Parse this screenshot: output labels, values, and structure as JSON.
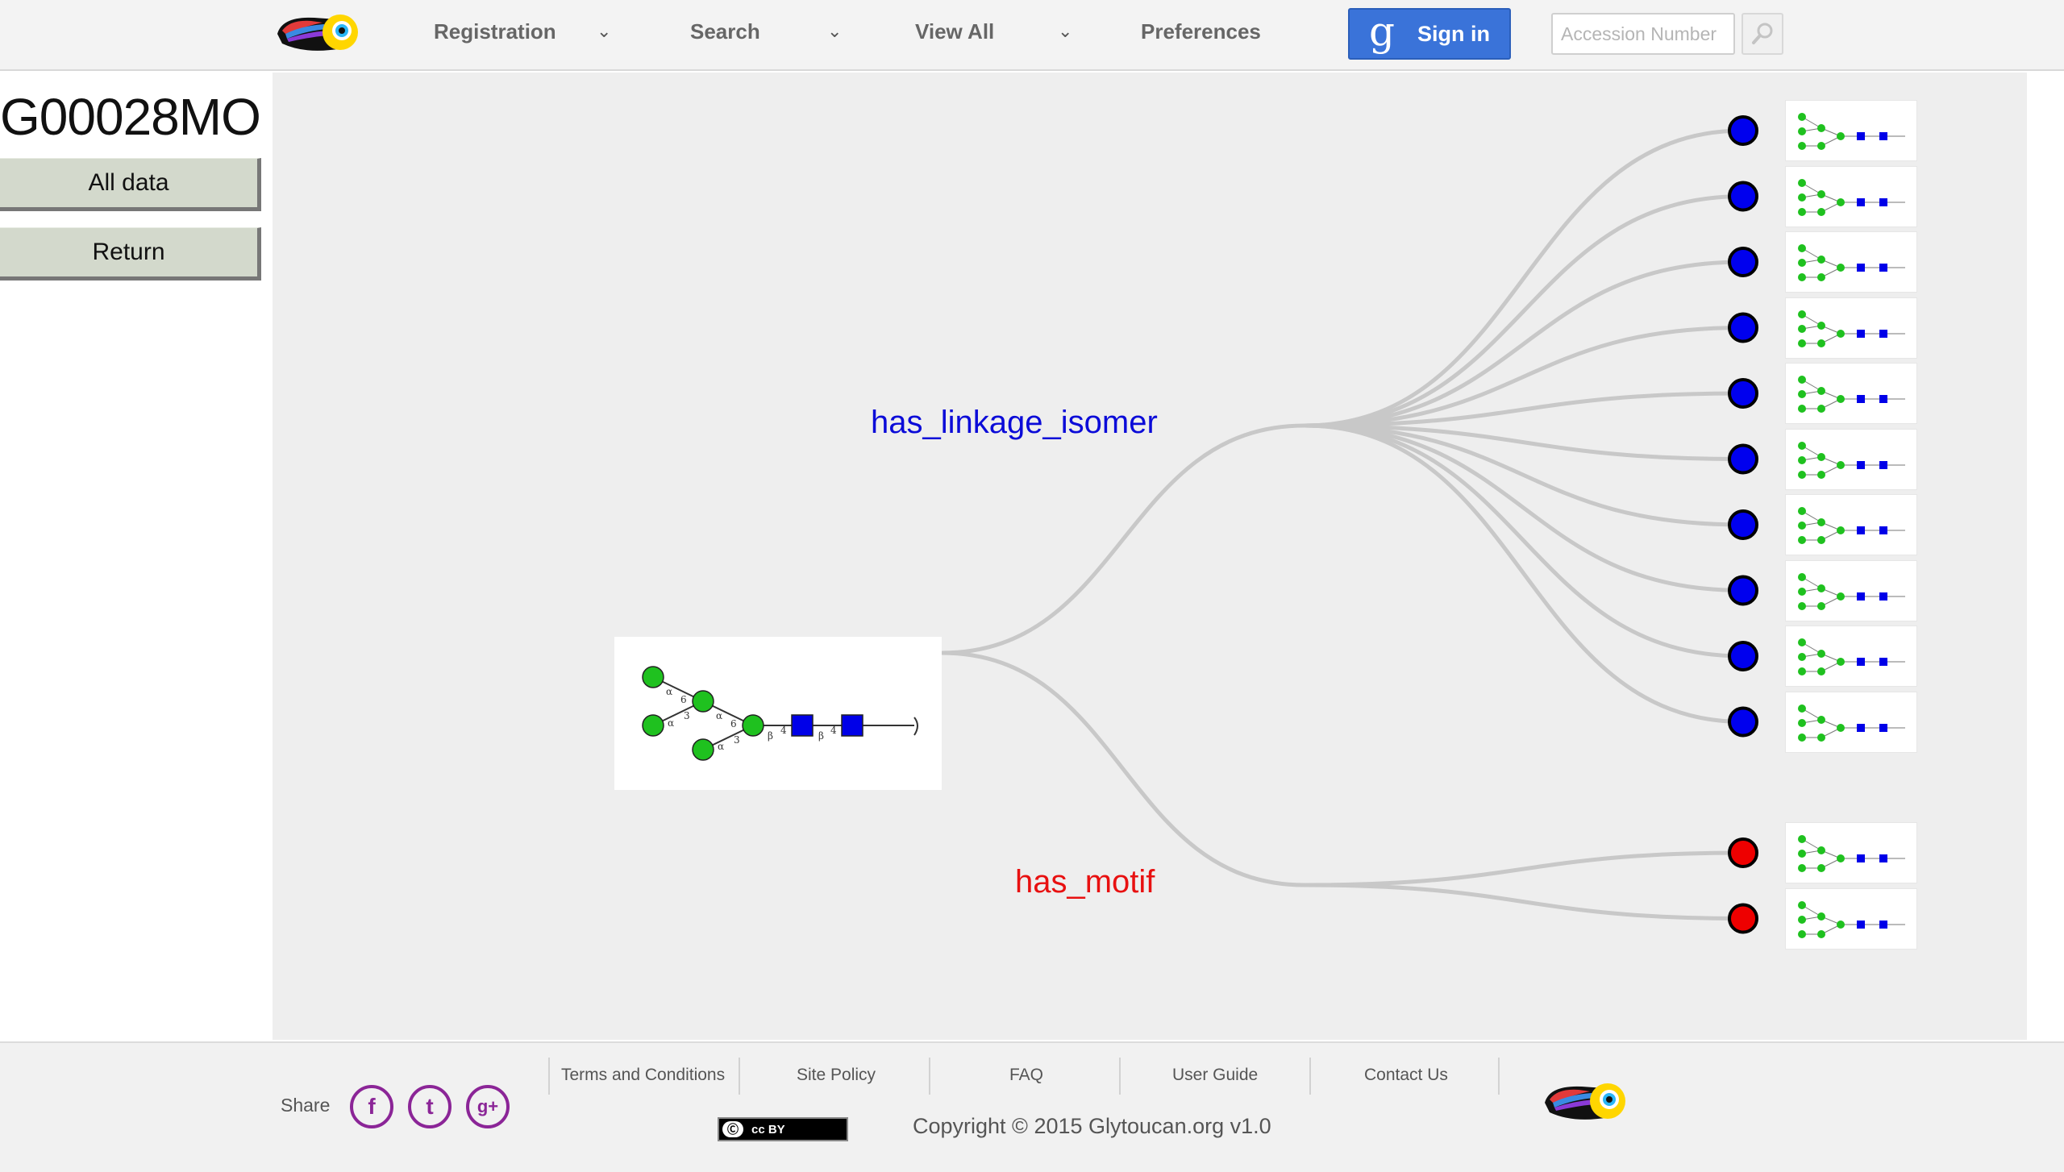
{
  "header": {
    "nav": [
      {
        "label": "Registration",
        "has_dropdown": true
      },
      {
        "label": "Search",
        "has_dropdown": true
      },
      {
        "label": "View All",
        "has_dropdown": true
      },
      {
        "label": "Preferences",
        "has_dropdown": false
      }
    ],
    "signin_label": "Sign in",
    "signin_icon": "g",
    "accession_placeholder": "Accession Number",
    "search_icon": "magnifier-icon"
  },
  "sidebar": {
    "title": "G00028MO",
    "buttons": [
      {
        "label": "All data"
      },
      {
        "label": "Return"
      }
    ]
  },
  "graph": {
    "relations": [
      {
        "label": "has_linkage_isomer",
        "color": "#0b0bd8",
        "node_color": "#0000ee",
        "count": 10
      },
      {
        "label": "has_motif",
        "color": "#e81010",
        "node_color": "#ee0000",
        "count": 2
      }
    ],
    "edge_color": "#c8c8c8",
    "glycan_colors": {
      "mannose": "#1fc11f",
      "glcnac": "#0000e8"
    },
    "linkage_text": [
      "α",
      "6",
      "α",
      "3",
      "α",
      "6",
      "α",
      "3",
      "β",
      "4",
      "β",
      "4"
    ]
  },
  "footer": {
    "share_label": "Share",
    "share_icons": [
      "facebook-icon",
      "twitter-icon",
      "google-plus-icon"
    ],
    "share_glyphs": [
      "f",
      "t",
      "g+"
    ],
    "links": [
      "Terms and Conditions",
      "Site Policy",
      "FAQ",
      "User Guide",
      "Contact Us"
    ],
    "license_badge": "cc BY",
    "copyright": "Copyright © 2015    Glytoucan.org v1.0"
  }
}
